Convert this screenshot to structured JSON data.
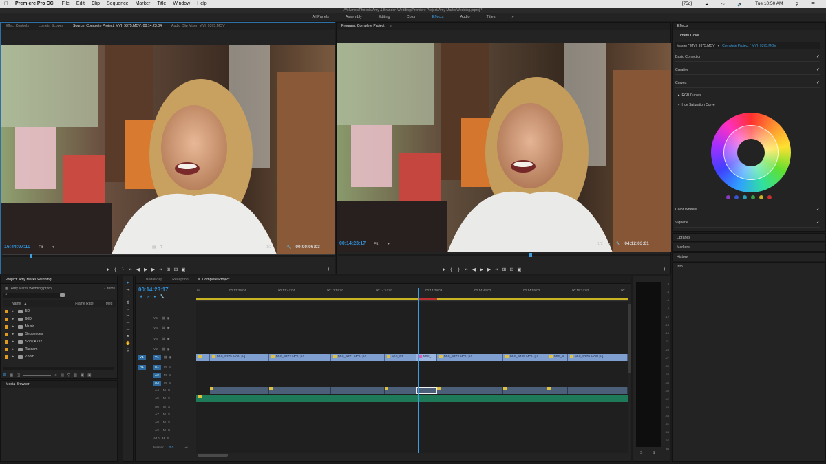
{
  "menubar": {
    "app": "Premiere Pro CC",
    "items": [
      "File",
      "Edit",
      "Clip",
      "Sequence",
      "Marker",
      "Title",
      "Window",
      "Help"
    ],
    "status": "[75d]",
    "time": "Tue 10:50 AM"
  },
  "path_title": "/Volumes/Phoenix/Amy & Brandon Wedding/Premiere Project/Amy Marks Wedding.prproj *",
  "workspaces": [
    "All Panels",
    "Assembly",
    "Editing",
    "Color",
    "Effects",
    "Audio",
    "Titles"
  ],
  "active_workspace": "Effects",
  "more_workspaces": "»",
  "source_panel": {
    "tabs": [
      "Effect Controls",
      "Lumetri Scopes",
      "Source: Complete Project: MVI_9375.MOV: 00:14:23:04",
      "Audio Clip Mixer: MVI_9375.MOV"
    ],
    "timecode": "16:44:07:10",
    "zoom": "Fit",
    "resolution": "1/2",
    "duration": "00:00:06:03"
  },
  "program_panel": {
    "tab": "Program: Complete Project",
    "timecode": "00:14:23:17",
    "zoom": "Fit",
    "resolution": "1/2",
    "duration": "04:12:03:01"
  },
  "effects_panel": {
    "title": "Effects",
    "lumetri_title": "Lumetri Color",
    "master_label": "Master * MVI_9375.MOV",
    "clip_label": "Complete Project * MVI_9375.MOV",
    "sections": {
      "basic": "Basic Correction",
      "creative": "Creative",
      "curves": "Curves",
      "rgb": "RGB Curves",
      "hue_sat": "Hue Saturation Curve",
      "wheels": "Color Wheels",
      "vignette": "Vignette"
    },
    "lower_panels": [
      "Libraries",
      "Markers",
      "History",
      "Info"
    ],
    "swatch_colors": [
      "#8a3bbf",
      "#3a55cf",
      "#2aa0b8",
      "#3aa048",
      "#c8b020",
      "#c83030"
    ]
  },
  "project_panel": {
    "title": "Project: Amy Marks Wedding",
    "file": "Amy Marks Wedding.prproj",
    "item_count": "7 Items",
    "columns": {
      "name": "Name",
      "frame_rate": "Frame Rate",
      "media": "Med"
    },
    "bins": [
      "5D",
      "60D",
      "Music",
      "Sequences",
      "Sony A7s2",
      "Tascam",
      "Zoom"
    ],
    "media_browser": "Media Browser"
  },
  "timeline": {
    "tabs": [
      "BridalPrep",
      "Reception",
      "Complete Project"
    ],
    "timecode": "00:14:23:17",
    "ruler": [
      "04",
      "00:13:29:04",
      "00:13:44:04",
      "00:13:59:03",
      "00:14:14:03",
      "00:14:29:03",
      "00:14:44:02",
      "00:14:59:02",
      "00:15:14:02",
      "00:"
    ],
    "video_tracks": [
      "V5",
      "V4",
      "V3",
      "V2",
      "V1"
    ],
    "audio_tracks": [
      "A1",
      "A2",
      "A3",
      "A4",
      "A5",
      "A6",
      "A7",
      "A8",
      "A9",
      "A10"
    ],
    "source_v": "V1",
    "source_a": "A1",
    "master": "Master",
    "master_value": "0.0",
    "clips": [
      "MVI_9375.MOV [V]",
      "MVI_9372.MOV [V]",
      "MVI_9371.MOV [V]",
      "MVI_93",
      "MVI_",
      "MVI_9373.MOV [V]",
      "MVI_9445.MOV [V]",
      "MVI_9",
      "MVI_9379.MOV [V]"
    ]
  },
  "meter": {
    "scale": [
      "0",
      "-3",
      "-6",
      "-9",
      "-12",
      "-15",
      "-18",
      "-21",
      "-24",
      "-27",
      "-30",
      "-33",
      "-36",
      "-39",
      "-42",
      "-45",
      "-48",
      "-51",
      "-54",
      "-57",
      "dB"
    ],
    "solo": [
      "S",
      "S"
    ]
  }
}
